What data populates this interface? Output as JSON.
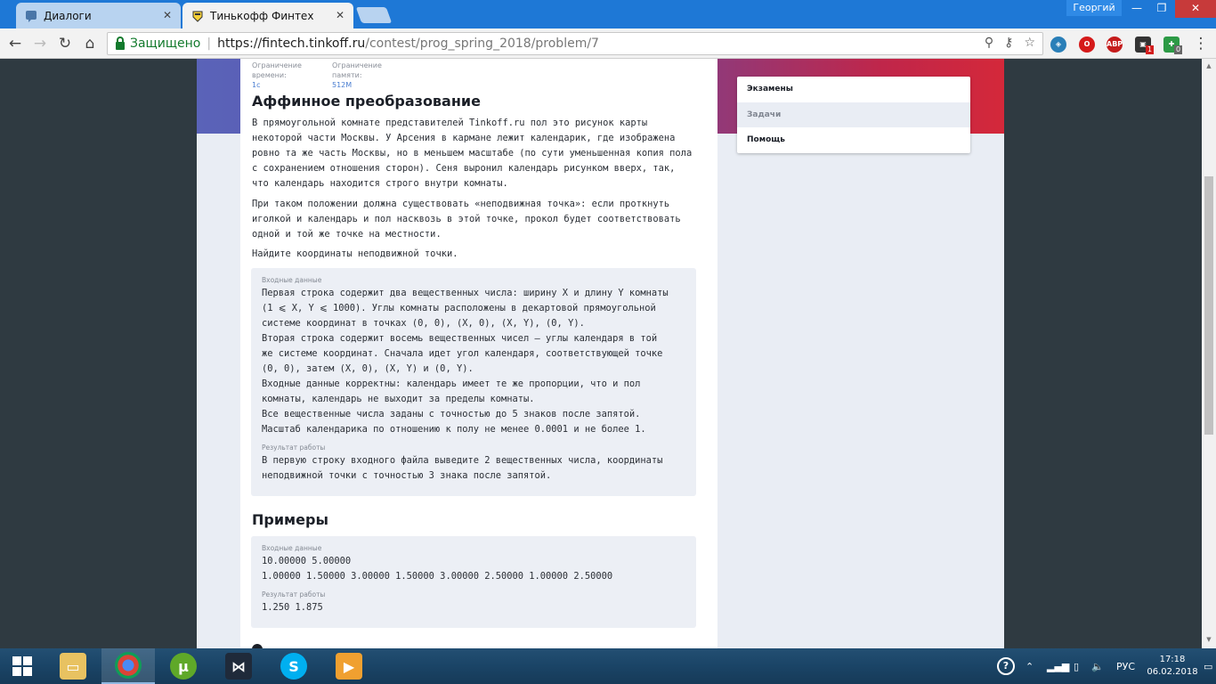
{
  "browser": {
    "tabs": [
      {
        "title": "Диалоги",
        "icon": "vk-icon",
        "active": false
      },
      {
        "title": "Тинькофф Финтех",
        "icon": "tinkoff-icon",
        "active": true
      }
    ],
    "user": "Георгий",
    "address": {
      "secure_label": "Защищено",
      "url_host": "https://fintech.tinkoff.ru",
      "url_path": "/contest/prog_spring_2018/problem/7"
    },
    "extensions": [
      {
        "name": "adblock-plus-icon",
        "label": "ABP"
      },
      {
        "name": "opera-icon",
        "badge": "1"
      },
      {
        "name": "puzzle-icon",
        "badge": "0"
      }
    ]
  },
  "problem": {
    "limits": [
      {
        "label": "Ограничение времени:",
        "value": "1с"
      },
      {
        "label": "Ограничение памяти:",
        "value": "512M"
      }
    ],
    "title": "Аффинное преобразование",
    "paragraphs": [
      "В прямоугольной комнате представителей Tinkoff.ru пол это рисунок карты некоторой части Москвы. У Арсения в кармане лежит календарик, где изображена ровно та же часть Москвы, но в меньшем масштабе (по сути уменьшенная копия пола с сохранением отношения сторон). Сеня выронил календарь рисунком вверх, так, что календарь находится строго внутри комнаты.",
      "При таком положении должна существовать «неподвижная точка»: если проткнуть иголкой и календарь и пол насквозь в этой точке, прокол будет соответствовать одной и той же точке на местности.",
      "Найдите координаты неподвижной точки."
    ],
    "input_label": "Входные данные",
    "input_lines": [
      "Первая строка содержит два вещественных числа: ширину X и длину Y комнаты",
      "(1 ⩽ X, Y ⩽ 1000). Углы комнаты расположены в декартовой прямоугольной",
      "системе координат в точках (0, 0), (X, 0), (X, Y), (0, Y).",
      "Вторая строка содержит восемь вещественных чисел — углы календаря в той",
      "же системе координат. Сначала идет угол календаря, соответствующей точке",
      "(0, 0), затем (X, 0), (X, Y) и (0, Y).",
      "Входные данные корректны: календарь имеет те же пропорции, что и пол",
      "комнаты, календарь не выходит за пределы комнаты.",
      "Все вещественные числа заданы с точностью до 5 знаков после запятой.",
      "Масштаб календарика по отношению к полу не менее 0.0001 и не более 1."
    ],
    "output_label": "Результат работы",
    "output_lines": [
      "В первую строку входного файла выведите 2 вещественных числа, координаты",
      "неподвижной точки с точностью 3 знака после запятой."
    ],
    "examples_title": "Примеры",
    "example": {
      "input_label": "Входные данные",
      "input_lines": [
        "10.00000 5.00000",
        "1.00000 1.50000 3.00000 1.50000 3.00000 2.50000 1.00000 2.50000"
      ],
      "output_label": "Результат работы",
      "output_lines": [
        "1.250 1.875"
      ]
    }
  },
  "menu": {
    "items": [
      {
        "label": "Экзамены",
        "selected": false
      },
      {
        "label": "Задачи",
        "selected": true
      },
      {
        "label": "Помощь",
        "selected": false
      }
    ]
  },
  "taskbar": {
    "apps": [
      "file-explorer-icon",
      "chrome-icon",
      "utorrent-icon",
      "visual-studio-icon",
      "skype-icon",
      "media-player-icon"
    ],
    "language": "РУС",
    "time": "17:18",
    "date": "06.02.2018"
  },
  "colors": {
    "accent_link": "#4a7ed1",
    "titlebar": "#1e78d6",
    "secure_green": "#137a2d"
  }
}
